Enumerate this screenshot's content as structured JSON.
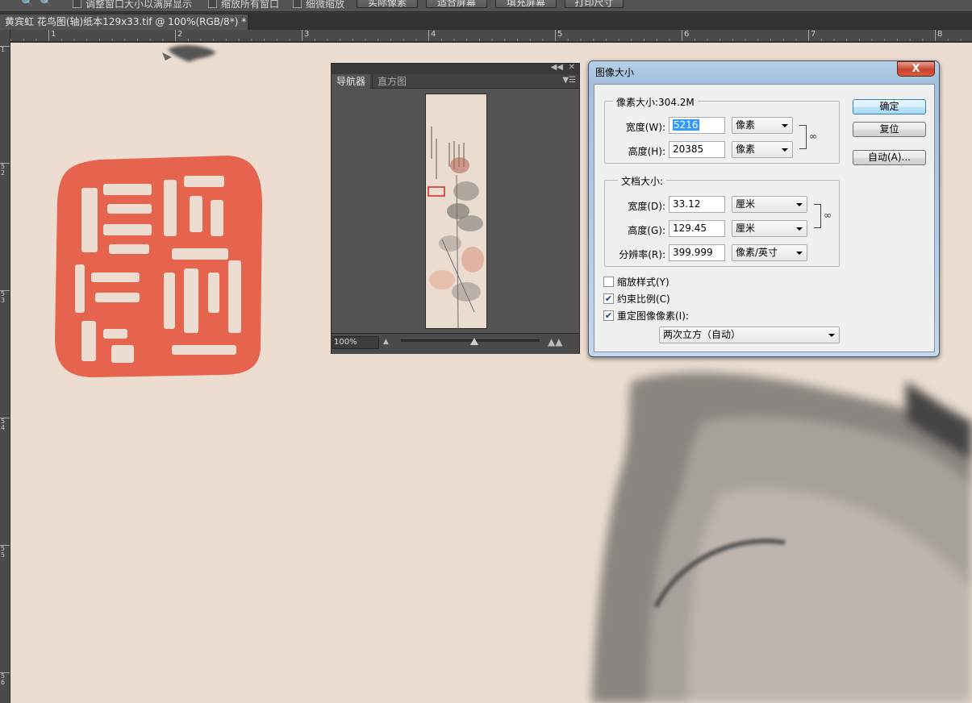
{
  "options_bar": {
    "zoom_in_icon": "zoom-in-icon",
    "zoom_out_icon": "zoom-out-icon",
    "resize_windows_label": "调整窗口大小以满屏显示",
    "zoom_all_windows_label": "缩放所有窗口",
    "scrubby_zoom_label": "细微缩放",
    "actual_pixels_label": "实际像素",
    "fit_screen_label": "适合屏幕",
    "fill_screen_label": "填充屏幕",
    "print_size_label": "打印尺寸"
  },
  "document_tab": {
    "title": "黄宾虹  花鸟图(轴)纸本129x33.tif @ 100%(RGB/8*) *"
  },
  "ruler": {
    "h_labels": [
      "1",
      "2",
      "3",
      "4",
      "5",
      "6",
      "7",
      "8"
    ],
    "v_labels": [
      "1",
      "5 2",
      "5 3",
      "5 4",
      "5 5",
      "5 6"
    ]
  },
  "navigator": {
    "tab_navigator": "导航器",
    "tab_histogram": "直方图",
    "zoom_value": "100%"
  },
  "image_size_dialog": {
    "title": "图像大小",
    "close_label": "X",
    "pixel_dimensions": {
      "legend": "像素大小:304.2M",
      "width_label": "宽度(W):",
      "width_value": "5216",
      "width_unit": "像素",
      "height_label": "高度(H):",
      "height_value": "20385",
      "height_unit": "像素"
    },
    "document_size": {
      "legend": "文档大小:",
      "width_label": "宽度(D):",
      "width_value": "33.12",
      "width_unit": "厘米",
      "height_label": "高度(G):",
      "height_value": "129.45",
      "height_unit": "厘米",
      "resolution_label": "分辨率(R):",
      "resolution_value": "399.999",
      "resolution_unit": "像素/英寸"
    },
    "scale_styles_label": "缩放样式(Y)",
    "scale_styles_checked": false,
    "constrain_label": "约束比例(C)",
    "constrain_checked": true,
    "resample_label": "重定图像像素(I):",
    "resample_checked": true,
    "resample_method": "两次立方（自动）",
    "ok_label": "确定",
    "reset_label": "复位",
    "auto_label": "自动(A)..."
  }
}
